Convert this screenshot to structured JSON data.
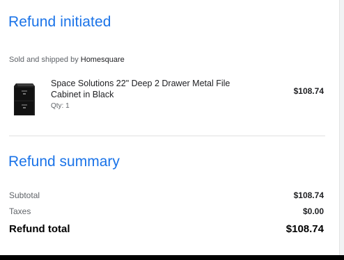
{
  "header": {
    "title": "Refund initiated"
  },
  "seller": {
    "prefix": "Sold and shipped by",
    "name": "Homesquare"
  },
  "item": {
    "name": "Space Solutions 22\" Deep 2 Drawer Metal File Cabinet in Black",
    "qty": "Qty: 1",
    "price": "$108.74",
    "icon": "file-cabinet-image"
  },
  "summary": {
    "title": "Refund summary",
    "subtotal_label": "Subtotal",
    "subtotal_value": "$108.74",
    "taxes_label": "Taxes",
    "taxes_value": "$0.00",
    "total_label": "Refund total",
    "total_value": "$108.74"
  },
  "colors": {
    "accent": "#1a73e8",
    "text": "#202124",
    "muted": "#5f6368"
  }
}
